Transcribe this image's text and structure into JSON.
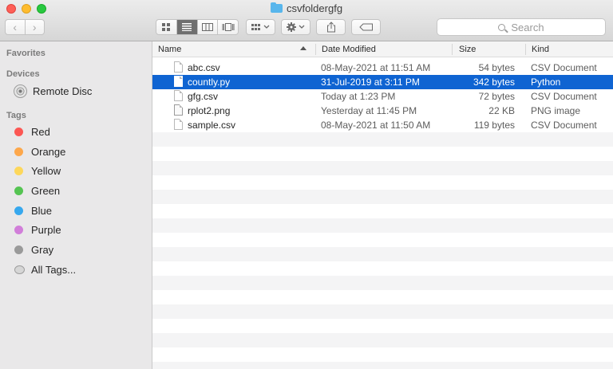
{
  "window": {
    "title": "csvfoldergfg"
  },
  "toolbar": {
    "search_placeholder": "Search"
  },
  "sidebar": {
    "favorites_heading": "Favorites",
    "devices_heading": "Devices",
    "devices": [
      {
        "label": "Remote Disc"
      }
    ],
    "tags_heading": "Tags",
    "tags": [
      {
        "label": "Red",
        "color": "#fc5753"
      },
      {
        "label": "Orange",
        "color": "#fda74b"
      },
      {
        "label": "Yellow",
        "color": "#fdd75b"
      },
      {
        "label": "Green",
        "color": "#55c452"
      },
      {
        "label": "Blue",
        "color": "#37a8ee"
      },
      {
        "label": "Purple",
        "color": "#d17ed9"
      },
      {
        "label": "Gray",
        "color": "#9a9a9a"
      }
    ],
    "all_tags_label": "All Tags..."
  },
  "filelist": {
    "columns": {
      "name": "Name",
      "date": "Date Modified",
      "size": "Size",
      "kind": "Kind"
    },
    "files": [
      {
        "name": "abc.csv",
        "date": "08-May-2021 at 11:51 AM",
        "size": "54 bytes",
        "kind": "CSV Document"
      },
      {
        "name": "countly.py",
        "date": "31-Jul-2019 at 3:11 PM",
        "size": "342 bytes",
        "kind": "Python"
      },
      {
        "name": "gfg.csv",
        "date": "Today at 1:23 PM",
        "size": "72 bytes",
        "kind": "CSV Document"
      },
      {
        "name": "rplot2.png",
        "date": "Yesterday at 11:45 PM",
        "size": "22 KB",
        "kind": "PNG image"
      },
      {
        "name": "sample.csv",
        "date": "08-May-2021 at 11:50 AM",
        "size": "119 bytes",
        "kind": "CSV Document"
      }
    ]
  }
}
